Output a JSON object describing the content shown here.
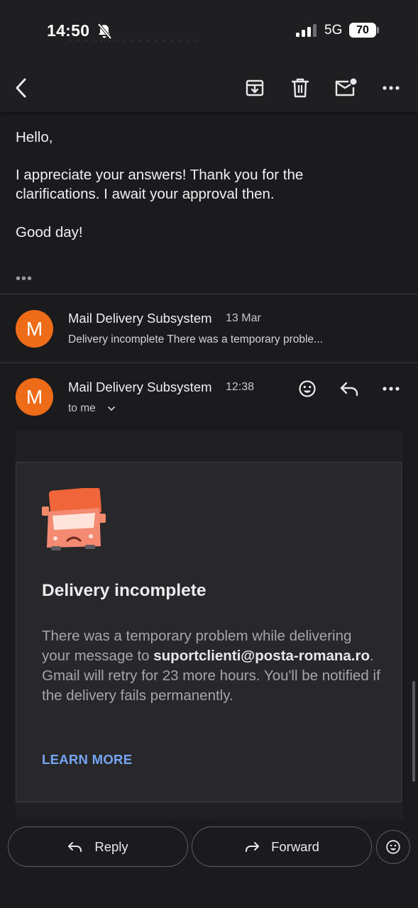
{
  "status_bar": {
    "time": "14:50",
    "network": "5G",
    "battery": "70"
  },
  "toolbar": {
    "icons": [
      "back-arrow-icon",
      "archive-icon",
      "trash-icon",
      "mark-unread-icon",
      "more-icon"
    ]
  },
  "previous_message": {
    "lines": [
      "Hello,",
      "I appreciate your answers! Thank you for the",
      "clarifications. I await your approval then.",
      "Good day!"
    ],
    "trimmed_indicator": "•••"
  },
  "collapsed_message": {
    "avatar_letter": "M",
    "sender": "Mail Delivery Subsystem",
    "date": "13 Mar",
    "snippet": "Delivery incomplete There was a temporary proble..."
  },
  "expanded_message": {
    "avatar_letter": "M",
    "sender": "Mail Delivery Subsystem",
    "time": "12:38",
    "recipient": "to me"
  },
  "notice_card": {
    "title": "Delivery incomplete",
    "body_before": "There was a temporary problem while delivering your message to ",
    "email": "suportclienti@posta-romana.ro",
    "body_after": ". Gmail will retry for 23 more hours. You'll be notified if the delivery fails permanently.",
    "link": "LEARN MORE"
  },
  "bottom_actions": {
    "reply": "Reply",
    "forward": "Forward"
  },
  "colors": {
    "avatar": "#ee6c18",
    "link": "#76a5f4",
    "background": "#1b1b1d",
    "card": "#28282b"
  }
}
